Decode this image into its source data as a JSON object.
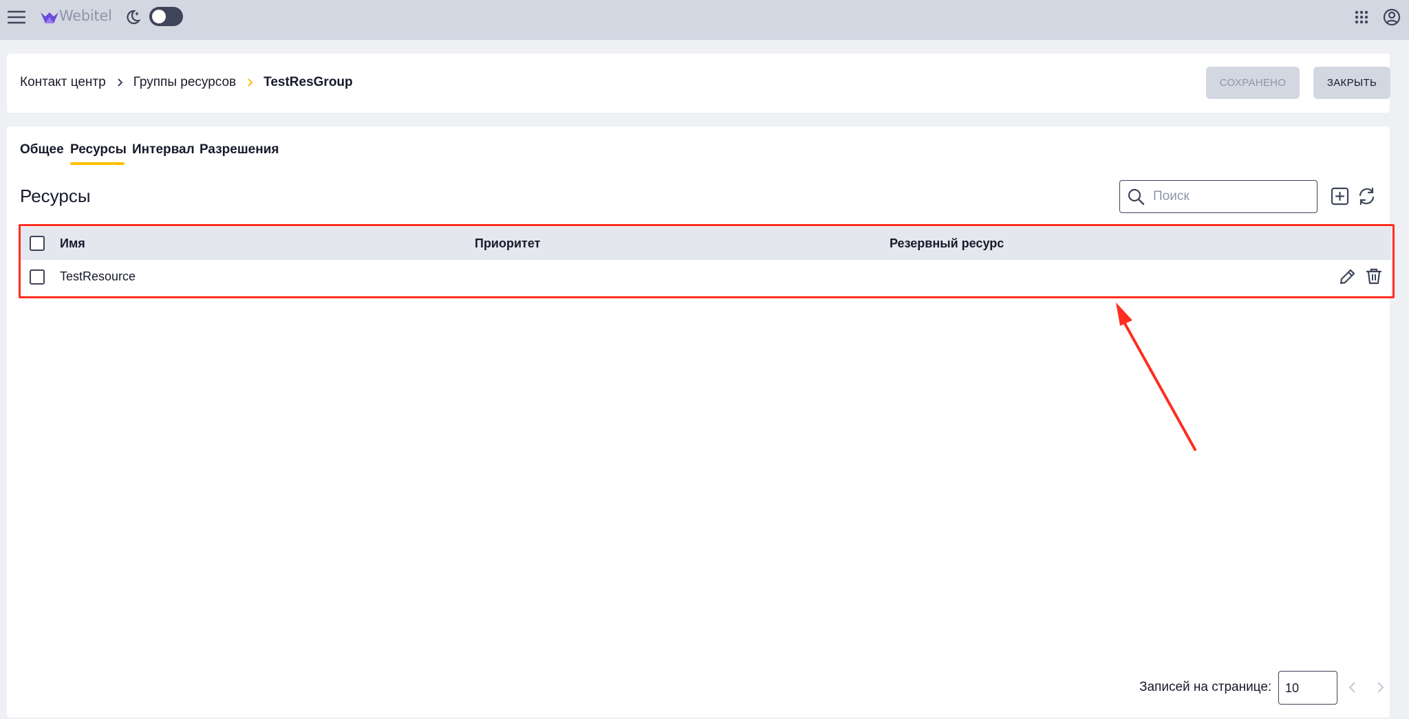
{
  "topbar": {
    "menu_icon": "hamburger-menu-icon",
    "logo_text": "Webitel",
    "theme_icon": "moon-stars-icon",
    "apps_icon": "apps-grid-icon",
    "account_icon": "user-circle-icon"
  },
  "header": {
    "breadcrumbs": [
      "Контакт центр",
      "Группы ресурсов",
      "TestResGroup"
    ],
    "saved_label": "Сохранено",
    "close_label": "Закрыть"
  },
  "tabs": [
    {
      "label": "Общее",
      "active": false
    },
    {
      "label": "Ресурсы",
      "active": true
    },
    {
      "label": "Интервал",
      "active": false
    },
    {
      "label": "Разрешения",
      "active": false
    }
  ],
  "section": {
    "title": "Ресурсы",
    "search_placeholder": "Поиск",
    "add_icon": "add-square-icon",
    "refresh_icon": "refresh-icon"
  },
  "table": {
    "columns": [
      "Имя",
      "Приоритет",
      "Резервный ресурс"
    ],
    "rows": [
      {
        "name": "TestResource",
        "priority": "",
        "reserve": ""
      }
    ]
  },
  "footer": {
    "per_page_label": "Записей на странице:",
    "per_page_value": "10"
  },
  "colors": {
    "accent": "#ffbf00",
    "highlight": "#ff2d1f",
    "topbar": "#d3d7e2"
  }
}
